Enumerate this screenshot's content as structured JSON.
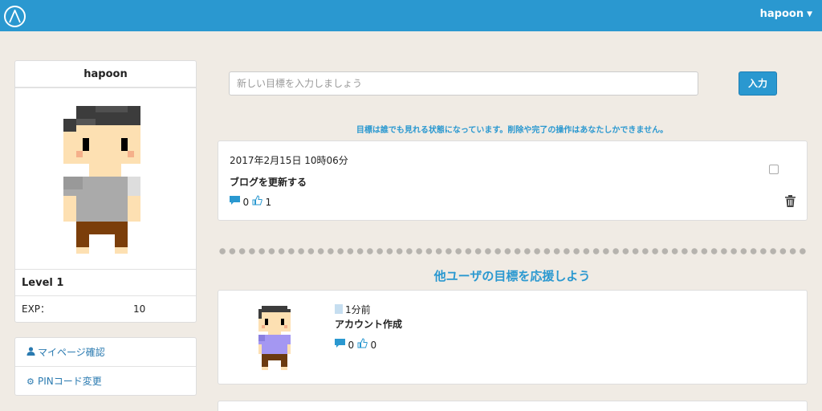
{
  "header": {
    "logo_icon": "mountain-logo-icon",
    "username": "hapoon"
  },
  "profile": {
    "name": "hapoon",
    "level_label": "Level 1",
    "exp_label": "EXP：",
    "exp_value": "10"
  },
  "links": [
    {
      "label": "マイページ確認",
      "icon": "user-icon"
    },
    {
      "label": "PINコード変更",
      "icon": "gear-icon"
    }
  ],
  "goal_form": {
    "placeholder": "新しい目標を入力しましょう",
    "submit_label": "入力"
  },
  "notice": "目標は誰でも見れる状態になっています。削除や完了の操作はあなたしかできません。",
  "my_goal": {
    "date": "2017年2月15日 10時06分",
    "title": "ブログを更新する",
    "comments": "0",
    "likes": "1"
  },
  "section_title": "他ユーザの目標を応援しよう",
  "other_goals": [
    {
      "time": "1分前",
      "title": "アカウント作成",
      "comments": "0",
      "likes": "0"
    }
  ],
  "colors": {
    "accent": "#2a98d0",
    "background": "#f0ebe4"
  }
}
